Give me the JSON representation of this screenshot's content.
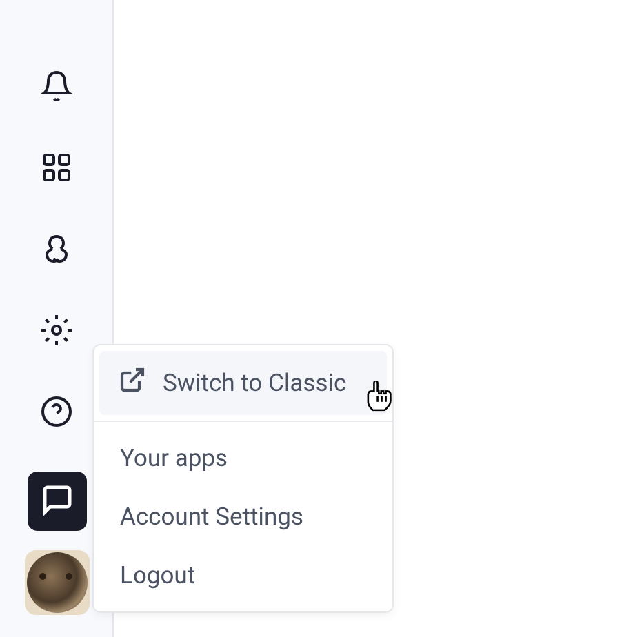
{
  "sidebar": {
    "icons": {
      "notifications": "bell-icon",
      "apps": "grid-icon",
      "webhooks": "webhook-icon",
      "settings": "gear-icon",
      "help": "help-icon",
      "chat": "chat-icon"
    }
  },
  "menu": {
    "items": [
      {
        "label": "Switch to Classic",
        "icon": "external-link-icon",
        "highlighted": true
      },
      {
        "label": "Your apps"
      },
      {
        "label": "Account Settings"
      },
      {
        "label": "Logout"
      }
    ]
  }
}
